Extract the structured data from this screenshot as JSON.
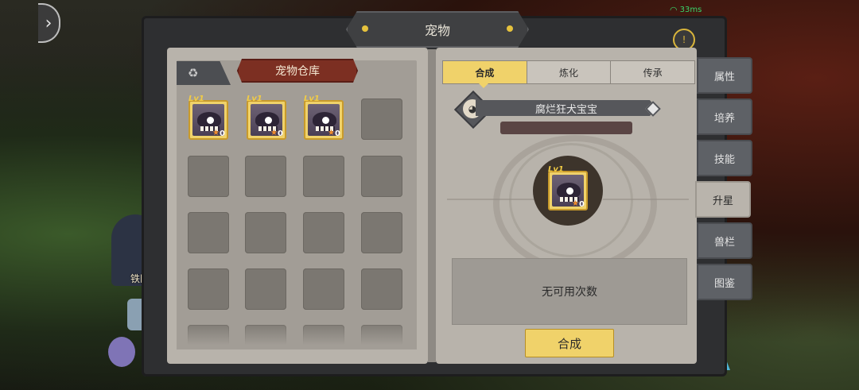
{
  "status_bar": {
    "ping": "33ms"
  },
  "window": {
    "title": "宠物",
    "back_icon": "chevron-right-icon"
  },
  "warehouse": {
    "title": "宠物仓库",
    "recycle_icon": "recycle-icon",
    "pets": [
      {
        "level": "Lv1",
        "count": "0"
      },
      {
        "level": "Lv1",
        "count": "0"
      },
      {
        "level": "Lv1",
        "count": "0"
      }
    ]
  },
  "tabs": [
    {
      "label": "合成",
      "active": true
    },
    {
      "label": "炼化",
      "active": false
    },
    {
      "label": "传承",
      "active": false
    }
  ],
  "selected_pet": {
    "name": "腐烂狂犬宝宝",
    "level": "Lv1",
    "count": "0"
  },
  "status": {
    "message": "无可用次数"
  },
  "action": {
    "label": "合成"
  },
  "side_menu": [
    {
      "label": "属性",
      "active": false
    },
    {
      "label": "培养",
      "active": false
    },
    {
      "label": "技能",
      "active": false
    },
    {
      "label": "升星",
      "active": true
    },
    {
      "label": "兽栏",
      "active": false
    },
    {
      "label": "图鉴",
      "active": false
    }
  ],
  "map": {
    "building_label": "铁匠"
  },
  "colors": {
    "accent": "#f0d26a",
    "banner": "#7c2f22",
    "page": "#b8b3ab"
  }
}
